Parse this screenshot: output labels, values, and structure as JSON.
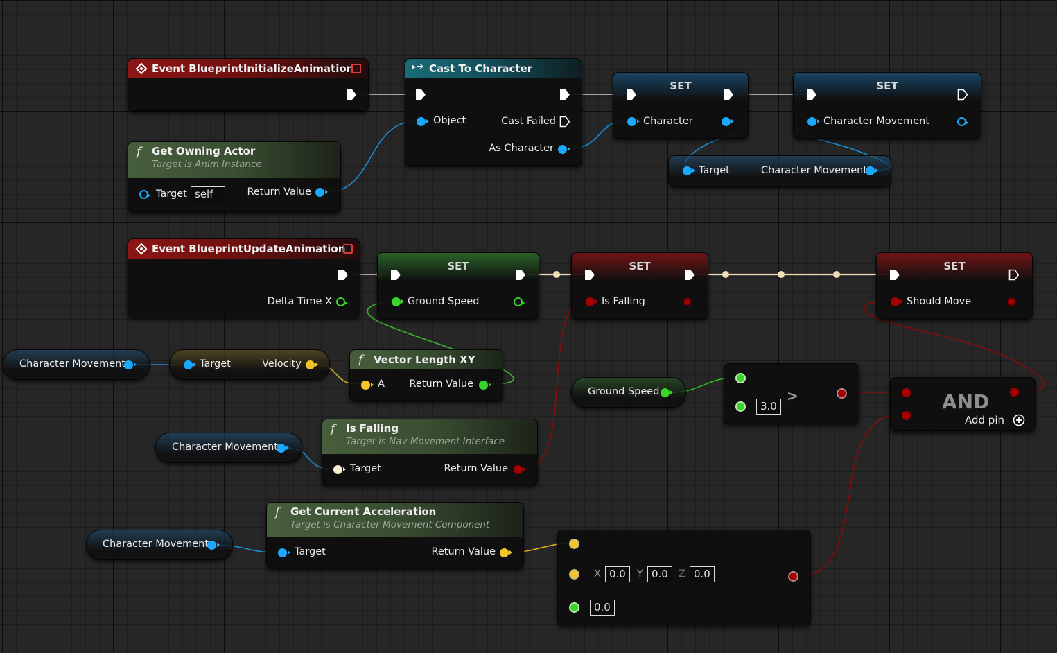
{
  "colors": {
    "exec": "#ffffff",
    "object": "#1ba8ff",
    "float": "#3bd42a",
    "bool": "#a50000",
    "vector": "#f3c529",
    "event_header": "#8d1616",
    "cast_header": "#1a6b78",
    "function_header": "#475e3c"
  },
  "nodes": {
    "event_init": {
      "title": "Event BlueprintInitializeAnimation",
      "icon": "event-diamond-icon"
    },
    "cast": {
      "title": "Cast To Character",
      "object": "Object",
      "cast_failed": "Cast Failed",
      "as_character": "As Character"
    },
    "set_character": {
      "title": "SET",
      "pin": "Character"
    },
    "set_char_movement": {
      "title": "SET",
      "pin": "Character Movement"
    },
    "get_owning_actor": {
      "title": "Get Owning Actor",
      "subtitle": "Target is Anim Instance",
      "target": "Target",
      "target_value": "self",
      "return": "Return Value"
    },
    "char_movement_getter": {
      "target": "Target",
      "value": "Character Movement"
    },
    "event_update": {
      "title": "Event BlueprintUpdateAnimation",
      "delta": "Delta Time X"
    },
    "set_ground_speed": {
      "title": "SET",
      "pin": "Ground Speed"
    },
    "set_is_falling": {
      "title": "SET",
      "pin": "Is Falling"
    },
    "set_should_move": {
      "title": "SET",
      "pin": "Should Move"
    },
    "cm_var_1": {
      "label": "Character Movement"
    },
    "velocity": {
      "target": "Target",
      "value": "Velocity"
    },
    "vector_length": {
      "title": "Vector Length XY",
      "a": "A",
      "return": "Return Value"
    },
    "is_falling": {
      "title": "Is Falling",
      "subtitle": "Target is Nav Movement Interface",
      "target": "Target",
      "return": "Return Value"
    },
    "cm_var_2": {
      "label": "Character Movement"
    },
    "ground_speed_var": {
      "label": "Ground Speed"
    },
    "greater": {
      "op": ">",
      "b": "3.0"
    },
    "and": {
      "title": "AND",
      "add_pin": "Add pin"
    },
    "get_accel": {
      "title": "Get Current Acceleration",
      "subtitle": "Target is Character Movement Component",
      "target": "Target",
      "return": "Return Value"
    },
    "cm_var_3": {
      "label": "Character Movement"
    },
    "not_equal": {
      "x_label": "X",
      "x": "0.0",
      "y_label": "Y",
      "y": "0.0",
      "z_label": "Z",
      "z": "0.0",
      "tolerance": "0.0"
    }
  }
}
